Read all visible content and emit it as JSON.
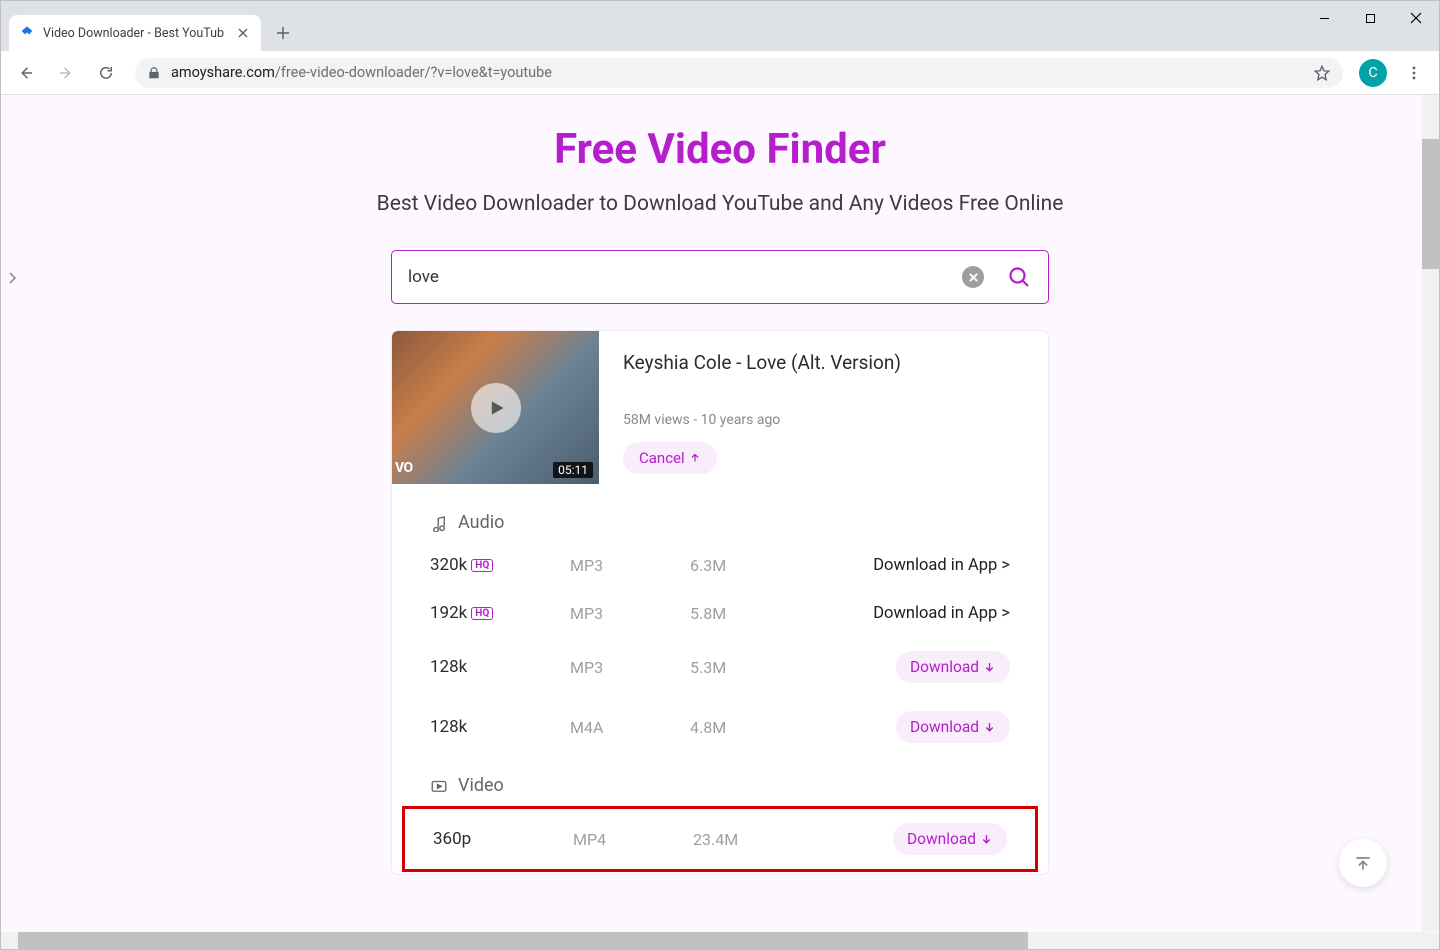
{
  "window": {
    "tab_title": "Video Downloader - Best YouTub",
    "url_host": "amoyshare.com",
    "url_path": "/free-video-downloader/?v=love&t=youtube",
    "avatar_letter": "C"
  },
  "page": {
    "title": "Free Video Finder",
    "subtitle": "Best Video Downloader to Download YouTube and Any Videos Free Online"
  },
  "search": {
    "value": "love"
  },
  "result": {
    "title": "Keyshia Cole - Love (Alt. Version)",
    "meta": "58M views - 10 years ago",
    "duration": "05:11",
    "vevo": "VO",
    "cancel_label": "Cancel"
  },
  "sections": {
    "audio_label": "Audio",
    "video_label": "Video"
  },
  "audio": [
    {
      "quality": "320k",
      "hq": "HQ",
      "format": "MP3",
      "size": "6.3M",
      "action": "Download in App >",
      "action_type": "app"
    },
    {
      "quality": "192k",
      "hq": "HQ",
      "format": "MP3",
      "size": "5.8M",
      "action": "Download in App >",
      "action_type": "app"
    },
    {
      "quality": "128k",
      "hq": "",
      "format": "MP3",
      "size": "5.3M",
      "action": "Download",
      "action_type": "download"
    },
    {
      "quality": "128k",
      "hq": "",
      "format": "M4A",
      "size": "4.8M",
      "action": "Download",
      "action_type": "download"
    }
  ],
  "video": [
    {
      "quality": "360p",
      "format": "MP4",
      "size": "23.4M",
      "action": "Download",
      "action_type": "download"
    }
  ],
  "colors": {
    "accent": "#b41ecb",
    "highlight": "#d40000"
  }
}
